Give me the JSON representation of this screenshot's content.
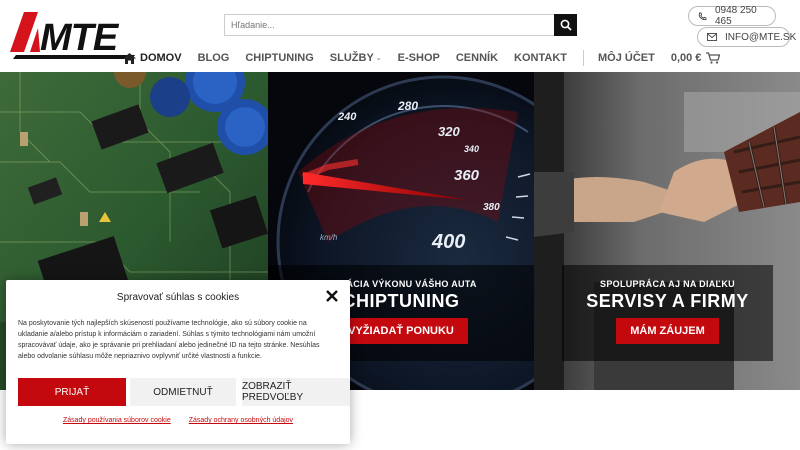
{
  "brand": {
    "logo_text": "MTE",
    "accent_color": "#c4090e"
  },
  "search": {
    "placeholder": "Hľadanie..."
  },
  "contact": {
    "phone": "0948 250 465",
    "email": "INFO@MTE.SK"
  },
  "nav": {
    "home": "DOMOV",
    "blog": "BLOG",
    "chiptuning": "CHIPTUNING",
    "services": "SLUŽBY",
    "eshop": "E-SHOP",
    "pricelist": "CENNÍK",
    "contact": "KONTAKT",
    "account": "MÔJ ÚČET",
    "cart_total": "0,00 €"
  },
  "hero": {
    "gauge_labels": [
      "240",
      "280",
      "320",
      "340",
      "360",
      "380",
      "400"
    ],
    "gauge_unit": "km/h",
    "panel2": {
      "subtitle": "ALIZÁCIA VÝKONU VÁŠHO AUTA",
      "title": "CHIPTUNING",
      "button": "VYŽIADAŤ PONUKU"
    },
    "panel3": {
      "subtitle": "SPOLUPRÁCA AJ NA DIAĽKU",
      "title": "SERVISY A FIRMY",
      "button": "MÁM ZÁUJEM"
    }
  },
  "cookie": {
    "title": "Spravovať súhlas s cookies",
    "text": "Na poskytovanie tých najlepších skúseností používame technológie, ako sú súbory cookie na ukladanie a/alebo prístup k informáciám o zariadení. Súhlas s týmito technológiami nám umožní spracovávať údaje, ako je správanie pri prehliadaní alebo jedinečné ID na tejto stránke. Nesúhlas alebo odvolanie súhlasu môže nepriaznivo ovplyvniť určité vlastnosti a funkcie.",
    "accept": "PRIJAŤ",
    "deny": "ODMIETNUŤ",
    "preferences": "ZOBRAZIŤ PREDVOĽBY",
    "cookie_policy_link": "Zásady používania súborov cookie",
    "privacy_link": "Zásady ochrany osobných údajov"
  }
}
